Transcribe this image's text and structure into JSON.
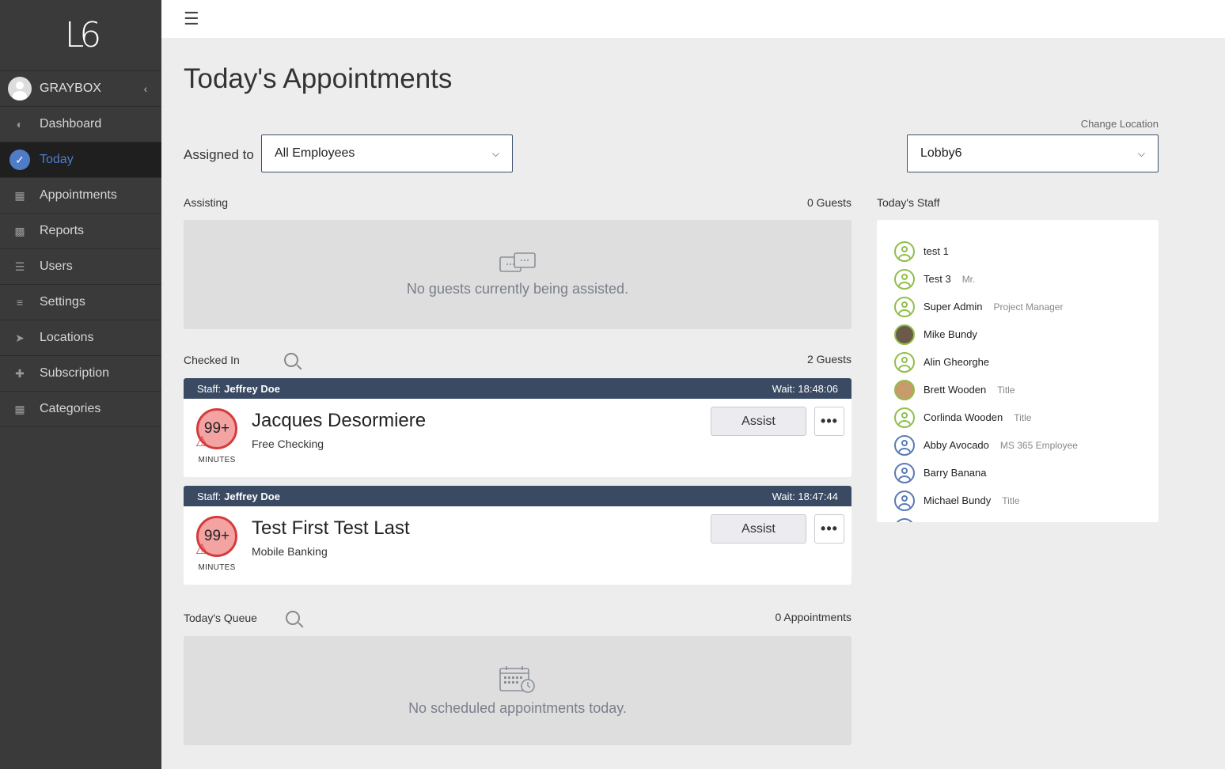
{
  "sidebar": {
    "logo": "L6",
    "user": "GRAYBOX",
    "items": [
      {
        "label": "Dashboard",
        "icon": "dashboard-icon"
      },
      {
        "label": "Today",
        "icon": "check-circle-icon"
      },
      {
        "label": "Appointments",
        "icon": "calendar-icon"
      },
      {
        "label": "Reports",
        "icon": "signal-bars-icon"
      },
      {
        "label": "Users",
        "icon": "list-icon"
      },
      {
        "label": "Settings",
        "icon": "sliders-icon"
      },
      {
        "label": "Locations",
        "icon": "location-arrow-icon"
      },
      {
        "label": "Subscription",
        "icon": "plus-icon"
      },
      {
        "label": "Categories",
        "icon": "grid-icon"
      }
    ]
  },
  "main": {
    "title": "Today's Appointments",
    "change_location": "Change Location",
    "assigned_label": "Assigned to",
    "assigned_value": "All Employees",
    "location_value": "Lobby6",
    "assisting": {
      "label": "Assisting",
      "count": "0 Guests",
      "empty": "No guests currently being assisted."
    },
    "checked_in": {
      "label": "Checked In",
      "count": "2 Guests",
      "cards": [
        {
          "staff_prefix": "Staff:",
          "staff": "Jeffrey Doe",
          "wait": "Wait: 18:48:06",
          "badge": "99+",
          "minutes": "MINUTES",
          "name": "Jacques Desormiere",
          "service": "Free Checking",
          "assist": "Assist",
          "more": "•••"
        },
        {
          "staff_prefix": "Staff:",
          "staff": "Jeffrey Doe",
          "wait": "Wait: 18:47:44",
          "badge": "99+",
          "minutes": "MINUTES",
          "name": "Test First Test Last",
          "service": "Mobile Banking",
          "assist": "Assist",
          "more": "•••"
        }
      ]
    },
    "queue": {
      "label": "Today's Queue",
      "count": "0 Appointments",
      "empty": "No scheduled appointments today."
    }
  },
  "staff": {
    "label": "Today's Staff",
    "list": [
      {
        "name": "test 1",
        "title": "",
        "avatar": "green"
      },
      {
        "name": "Test 3",
        "title": "Mr.",
        "avatar": "green"
      },
      {
        "name": "Super Admin",
        "title": "Project Manager",
        "avatar": "green"
      },
      {
        "name": "Mike Bundy",
        "title": "",
        "avatar": "photo"
      },
      {
        "name": "Alin Gheorghe",
        "title": "",
        "avatar": "green"
      },
      {
        "name": "Brett Wooden",
        "title": "Title",
        "avatar": "photo2"
      },
      {
        "name": "Corlinda Wooden",
        "title": "Title",
        "avatar": "green"
      },
      {
        "name": "Abby Avocado",
        "title": "MS 365 Employee",
        "avatar": "blue"
      },
      {
        "name": "Barry Banana",
        "title": "",
        "avatar": "blue"
      },
      {
        "name": "Michael Bundy",
        "title": "Title",
        "avatar": "blue"
      },
      {
        "name": "",
        "title": "",
        "avatar": "blue"
      }
    ]
  }
}
